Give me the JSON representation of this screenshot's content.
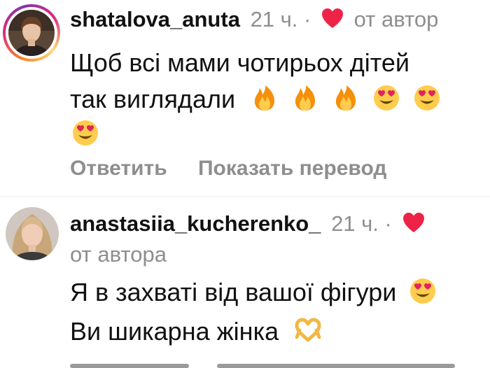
{
  "comments": [
    {
      "username": "shatalova_anuta",
      "time": "21 ч.",
      "dot": "·",
      "author_badge": "от автор",
      "text_line1": "Щоб всі мами чотирьох дітей",
      "text_line2": "так виглядали",
      "emojis_line2": [
        "fire-emoji",
        "fire-emoji",
        "fire-emoji",
        "heart-eyes-emoji",
        "heart-eyes-emoji"
      ],
      "emojis_line3": [
        "heart-eyes-emoji"
      ],
      "reply_label": "Ответить",
      "translate_label": "Показать перевод",
      "story_ring": true
    },
    {
      "username": "anastasiia_kucherenko_",
      "time": "21 ч.",
      "dot": "·",
      "author_badge": "от автора",
      "text_line1": "Я в захваті від вашої фігури",
      "text_line2": "Ви шикарна жінка",
      "emojis_line1": [
        "heart-eyes-emoji"
      ],
      "emojis_line2": [
        "heart-hands-emoji"
      ],
      "story_ring": false
    }
  ],
  "colors": {
    "username": "#111111",
    "secondary": "#8e8e8e",
    "liked_heart": "#ed2447",
    "story_ring": [
      "#f58529",
      "#dd2a7b",
      "#8134af"
    ]
  }
}
